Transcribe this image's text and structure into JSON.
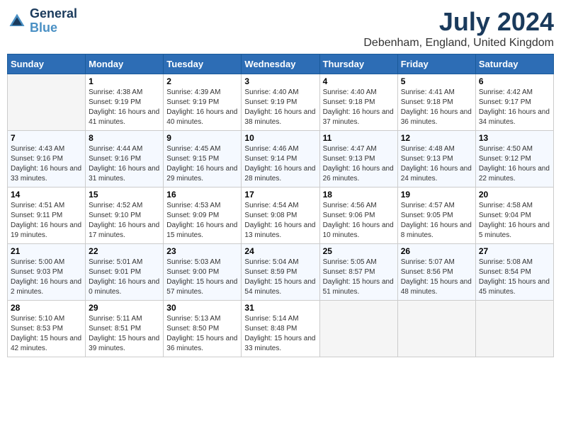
{
  "logo": {
    "line1": "General",
    "line2": "Blue"
  },
  "title": "July 2024",
  "location": "Debenham, England, United Kingdom",
  "days_of_week": [
    "Sunday",
    "Monday",
    "Tuesday",
    "Wednesday",
    "Thursday",
    "Friday",
    "Saturday"
  ],
  "weeks": [
    [
      {
        "day": "",
        "sunrise": "",
        "sunset": "",
        "daylight": "",
        "empty": true
      },
      {
        "day": "1",
        "sunrise": "Sunrise: 4:38 AM",
        "sunset": "Sunset: 9:19 PM",
        "daylight": "Daylight: 16 hours and 41 minutes."
      },
      {
        "day": "2",
        "sunrise": "Sunrise: 4:39 AM",
        "sunset": "Sunset: 9:19 PM",
        "daylight": "Daylight: 16 hours and 40 minutes."
      },
      {
        "day": "3",
        "sunrise": "Sunrise: 4:40 AM",
        "sunset": "Sunset: 9:19 PM",
        "daylight": "Daylight: 16 hours and 38 minutes."
      },
      {
        "day": "4",
        "sunrise": "Sunrise: 4:40 AM",
        "sunset": "Sunset: 9:18 PM",
        "daylight": "Daylight: 16 hours and 37 minutes."
      },
      {
        "day": "5",
        "sunrise": "Sunrise: 4:41 AM",
        "sunset": "Sunset: 9:18 PM",
        "daylight": "Daylight: 16 hours and 36 minutes."
      },
      {
        "day": "6",
        "sunrise": "Sunrise: 4:42 AM",
        "sunset": "Sunset: 9:17 PM",
        "daylight": "Daylight: 16 hours and 34 minutes."
      }
    ],
    [
      {
        "day": "7",
        "sunrise": "Sunrise: 4:43 AM",
        "sunset": "Sunset: 9:16 PM",
        "daylight": "Daylight: 16 hours and 33 minutes."
      },
      {
        "day": "8",
        "sunrise": "Sunrise: 4:44 AM",
        "sunset": "Sunset: 9:16 PM",
        "daylight": "Daylight: 16 hours and 31 minutes."
      },
      {
        "day": "9",
        "sunrise": "Sunrise: 4:45 AM",
        "sunset": "Sunset: 9:15 PM",
        "daylight": "Daylight: 16 hours and 29 minutes."
      },
      {
        "day": "10",
        "sunrise": "Sunrise: 4:46 AM",
        "sunset": "Sunset: 9:14 PM",
        "daylight": "Daylight: 16 hours and 28 minutes."
      },
      {
        "day": "11",
        "sunrise": "Sunrise: 4:47 AM",
        "sunset": "Sunset: 9:13 PM",
        "daylight": "Daylight: 16 hours and 26 minutes."
      },
      {
        "day": "12",
        "sunrise": "Sunrise: 4:48 AM",
        "sunset": "Sunset: 9:13 PM",
        "daylight": "Daylight: 16 hours and 24 minutes."
      },
      {
        "day": "13",
        "sunrise": "Sunrise: 4:50 AM",
        "sunset": "Sunset: 9:12 PM",
        "daylight": "Daylight: 16 hours and 22 minutes."
      }
    ],
    [
      {
        "day": "14",
        "sunrise": "Sunrise: 4:51 AM",
        "sunset": "Sunset: 9:11 PM",
        "daylight": "Daylight: 16 hours and 19 minutes."
      },
      {
        "day": "15",
        "sunrise": "Sunrise: 4:52 AM",
        "sunset": "Sunset: 9:10 PM",
        "daylight": "Daylight: 16 hours and 17 minutes."
      },
      {
        "day": "16",
        "sunrise": "Sunrise: 4:53 AM",
        "sunset": "Sunset: 9:09 PM",
        "daylight": "Daylight: 16 hours and 15 minutes."
      },
      {
        "day": "17",
        "sunrise": "Sunrise: 4:54 AM",
        "sunset": "Sunset: 9:08 PM",
        "daylight": "Daylight: 16 hours and 13 minutes."
      },
      {
        "day": "18",
        "sunrise": "Sunrise: 4:56 AM",
        "sunset": "Sunset: 9:06 PM",
        "daylight": "Daylight: 16 hours and 10 minutes."
      },
      {
        "day": "19",
        "sunrise": "Sunrise: 4:57 AM",
        "sunset": "Sunset: 9:05 PM",
        "daylight": "Daylight: 16 hours and 8 minutes."
      },
      {
        "day": "20",
        "sunrise": "Sunrise: 4:58 AM",
        "sunset": "Sunset: 9:04 PM",
        "daylight": "Daylight: 16 hours and 5 minutes."
      }
    ],
    [
      {
        "day": "21",
        "sunrise": "Sunrise: 5:00 AM",
        "sunset": "Sunset: 9:03 PM",
        "daylight": "Daylight: 16 hours and 2 minutes."
      },
      {
        "day": "22",
        "sunrise": "Sunrise: 5:01 AM",
        "sunset": "Sunset: 9:01 PM",
        "daylight": "Daylight: 16 hours and 0 minutes."
      },
      {
        "day": "23",
        "sunrise": "Sunrise: 5:03 AM",
        "sunset": "Sunset: 9:00 PM",
        "daylight": "Daylight: 15 hours and 57 minutes."
      },
      {
        "day": "24",
        "sunrise": "Sunrise: 5:04 AM",
        "sunset": "Sunset: 8:59 PM",
        "daylight": "Daylight: 15 hours and 54 minutes."
      },
      {
        "day": "25",
        "sunrise": "Sunrise: 5:05 AM",
        "sunset": "Sunset: 8:57 PM",
        "daylight": "Daylight: 15 hours and 51 minutes."
      },
      {
        "day": "26",
        "sunrise": "Sunrise: 5:07 AM",
        "sunset": "Sunset: 8:56 PM",
        "daylight": "Daylight: 15 hours and 48 minutes."
      },
      {
        "day": "27",
        "sunrise": "Sunrise: 5:08 AM",
        "sunset": "Sunset: 8:54 PM",
        "daylight": "Daylight: 15 hours and 45 minutes."
      }
    ],
    [
      {
        "day": "28",
        "sunrise": "Sunrise: 5:10 AM",
        "sunset": "Sunset: 8:53 PM",
        "daylight": "Daylight: 15 hours and 42 minutes."
      },
      {
        "day": "29",
        "sunrise": "Sunrise: 5:11 AM",
        "sunset": "Sunset: 8:51 PM",
        "daylight": "Daylight: 15 hours and 39 minutes."
      },
      {
        "day": "30",
        "sunrise": "Sunrise: 5:13 AM",
        "sunset": "Sunset: 8:50 PM",
        "daylight": "Daylight: 15 hours and 36 minutes."
      },
      {
        "day": "31",
        "sunrise": "Sunrise: 5:14 AM",
        "sunset": "Sunset: 8:48 PM",
        "daylight": "Daylight: 15 hours and 33 minutes."
      },
      {
        "day": "",
        "sunrise": "",
        "sunset": "",
        "daylight": "",
        "empty": true
      },
      {
        "day": "",
        "sunrise": "",
        "sunset": "",
        "daylight": "",
        "empty": true
      },
      {
        "day": "",
        "sunrise": "",
        "sunset": "",
        "daylight": "",
        "empty": true
      }
    ]
  ]
}
